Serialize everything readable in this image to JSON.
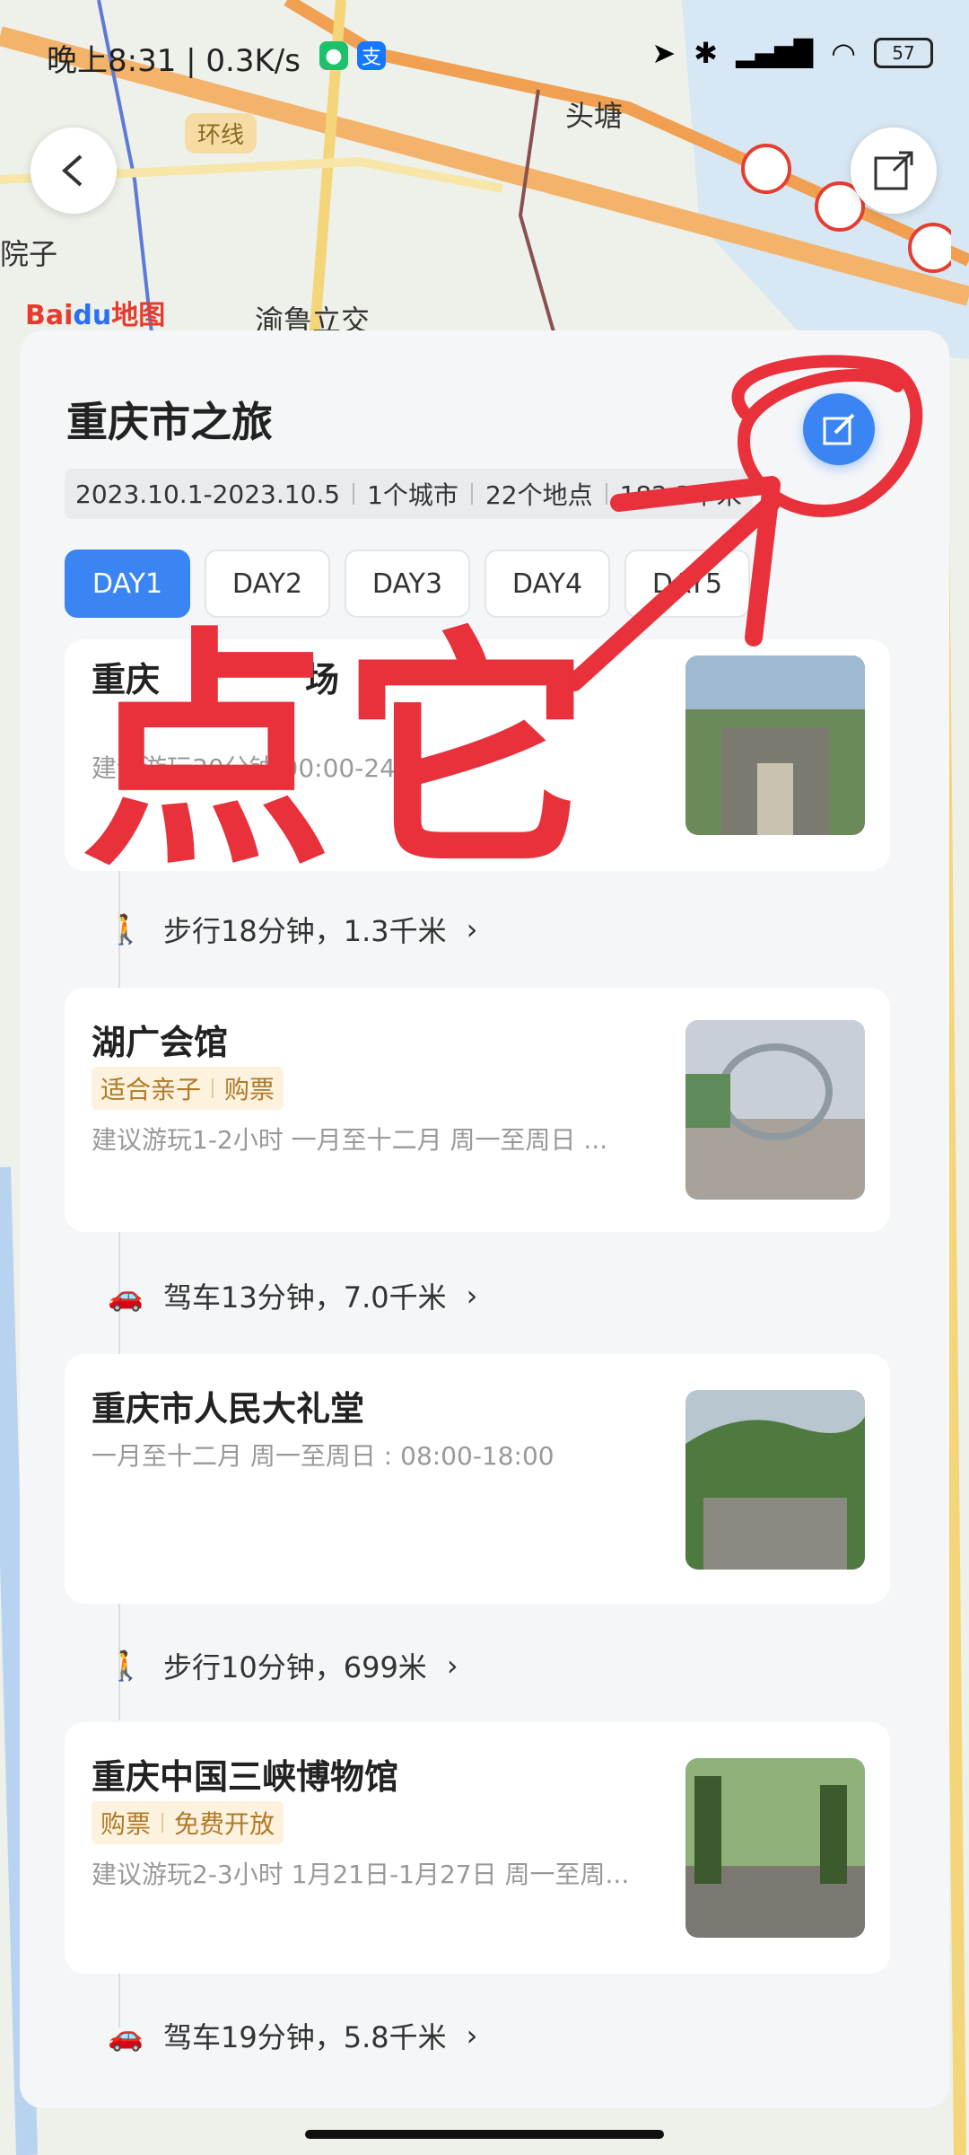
{
  "status_bar": {
    "time": "晚上8:31 | 0.3K/s",
    "battery": "57"
  },
  "map": {
    "ring_label": "环线",
    "station": "头塘",
    "interchange": "渝鲁立交",
    "left_edge_label": "院子",
    "logo_text_a": "Bai",
    "logo_text_b": "du",
    "logo_text_c": "地图"
  },
  "trip": {
    "title": "重庆市之旅",
    "dates": "2023.10.1-2023.10.5",
    "cities": "1个城市",
    "places": "22个地点",
    "distance": "182.3千米"
  },
  "tabs": [
    {
      "label": "DAY1"
    },
    {
      "label": "DAY2"
    },
    {
      "label": "DAY3"
    },
    {
      "label": "DAY4"
    },
    {
      "label": "DAY5"
    }
  ],
  "cards": [
    {
      "name": "重庆",
      "name_suffix": "场",
      "desc": "建议游玩30分钟 00:00-24:00"
    },
    {
      "name": "湖广会馆",
      "tag1": "适合亲子",
      "tag2": "购票",
      "desc": "建议游玩1-2小时 一月至十二月 周一至周日 ..."
    },
    {
      "name": "重庆市人民大礼堂",
      "desc": "一月至十二月 周一至周日 : 08:00-18:00"
    },
    {
      "name": "重庆中国三峡博物馆",
      "tag1": "购票",
      "tag2": "免费开放",
      "desc": "建议游玩2-3小时 1月21日-1月27日 周一至周..."
    }
  ],
  "routes": [
    {
      "text": "步行18分钟，1.3千米",
      "icon": "walk-icon"
    },
    {
      "text": "驾车13分钟，7.0千米",
      "icon": "car-icon"
    },
    {
      "text": "步行10分钟，699米",
      "icon": "walk-icon"
    },
    {
      "text": "驾车19分钟，5.8千米",
      "icon": "car-icon"
    }
  ],
  "annotation": {
    "text": "点它"
  }
}
